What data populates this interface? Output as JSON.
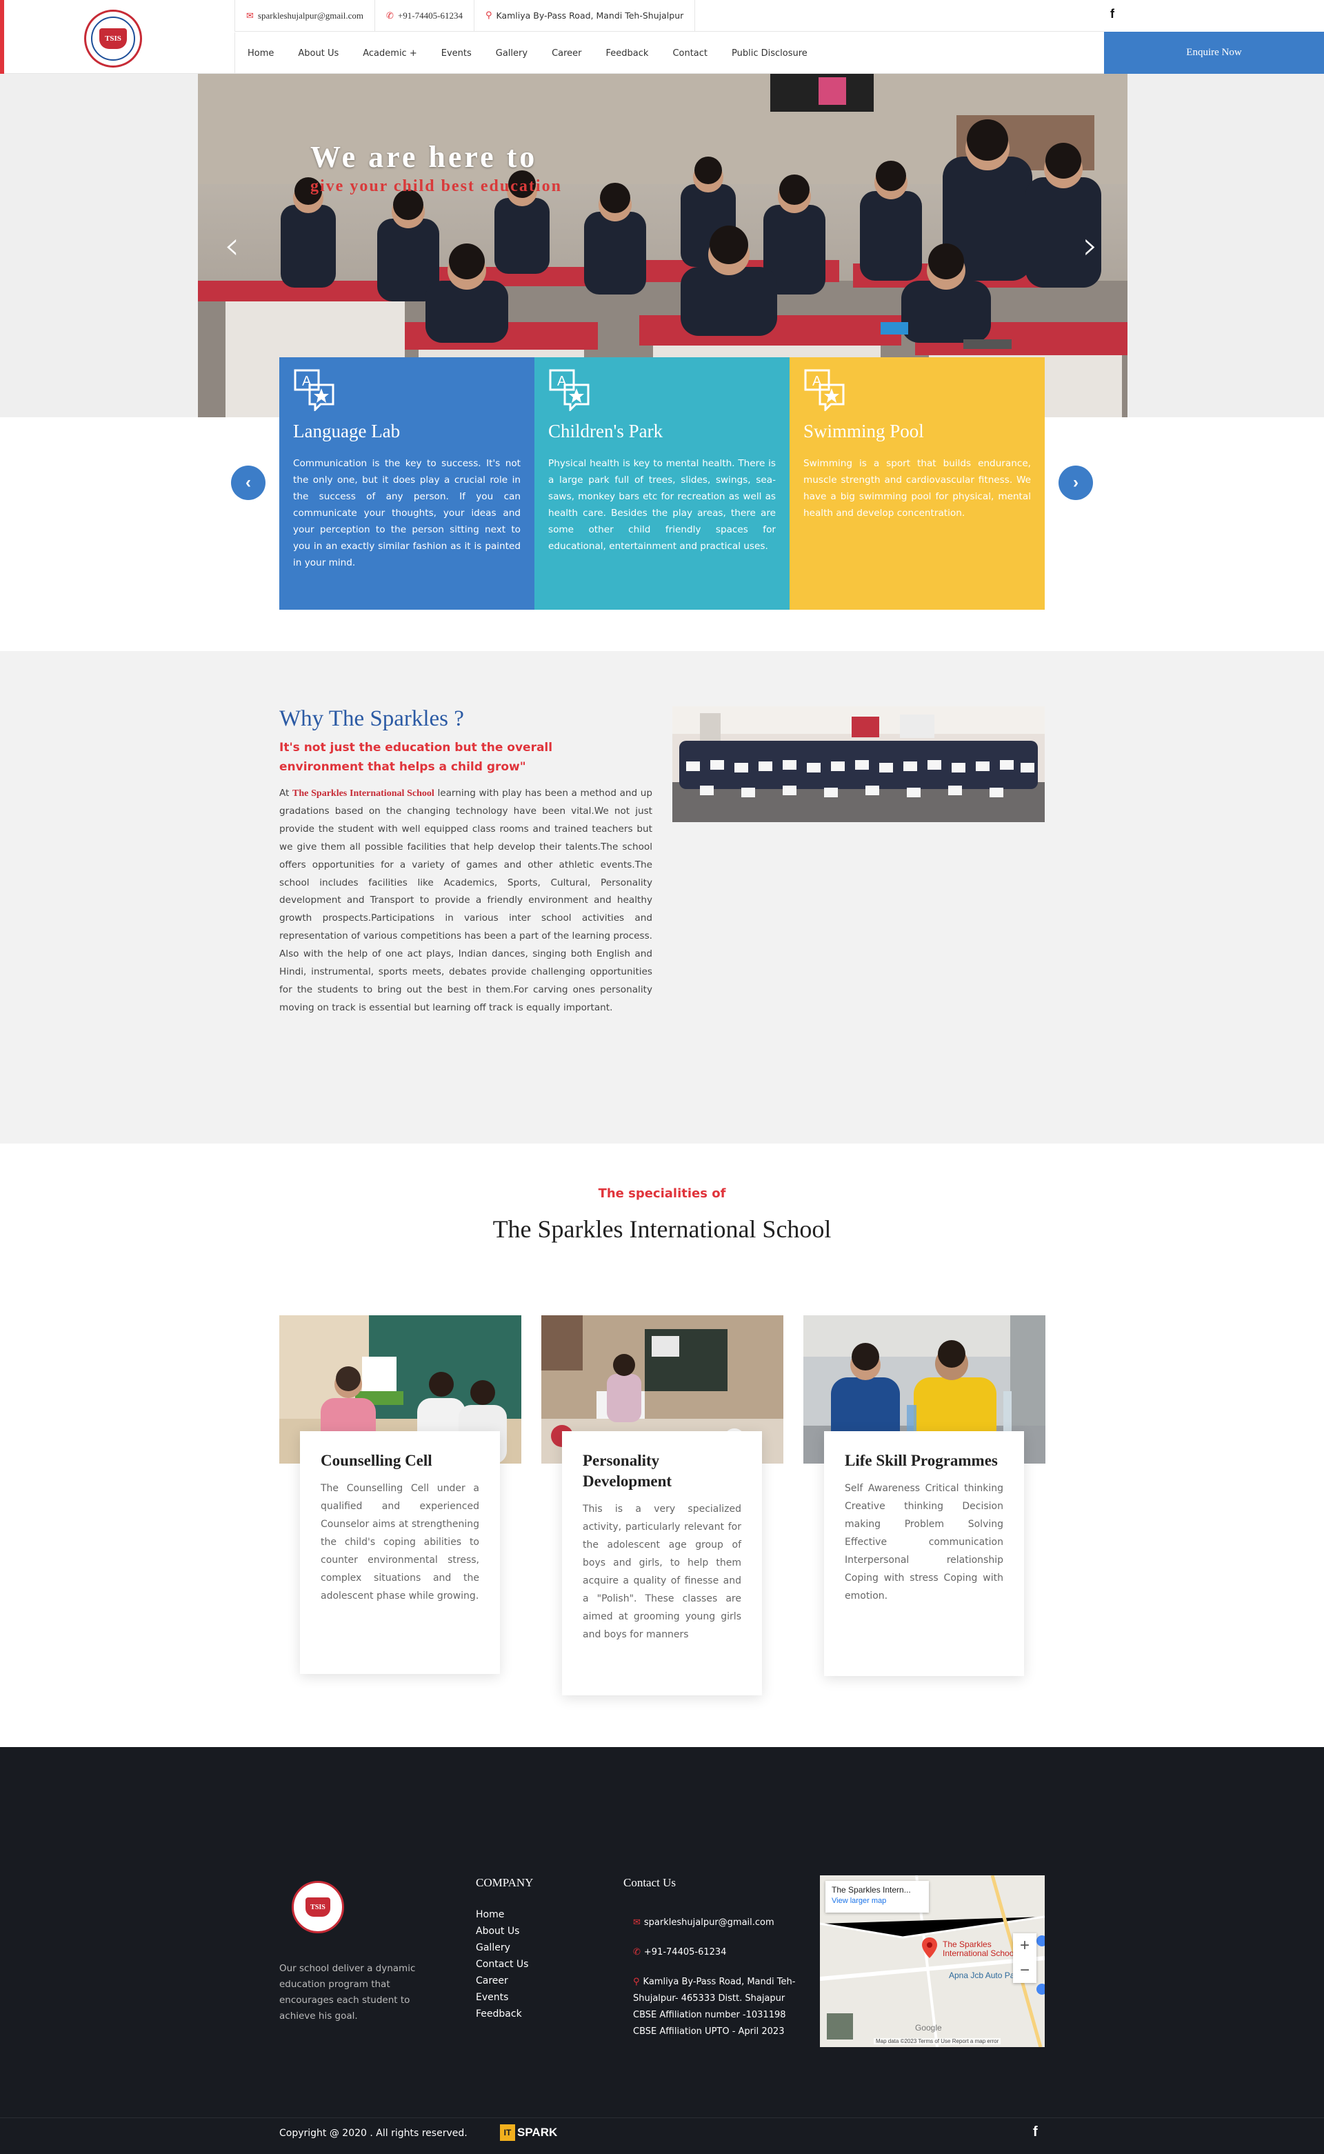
{
  "header": {
    "email": "sparkleshujalpur@gmail.com",
    "phone": "+91-74405-61234",
    "address": "Kamliya By-Pass Road, Mandi Teh-Shujalpur",
    "social_icon": "facebook-icon",
    "logo_text": "TSIS",
    "nav": [
      "Home",
      "About Us",
      "Academic +",
      "Events",
      "Gallery",
      "Career",
      "Feedback",
      "Contact",
      "Public Disclosure"
    ],
    "cta": "Enquire Now"
  },
  "hero": {
    "line1": "We are here to",
    "line2": "give your child best education",
    "prev_icon": "chevron-left-icon",
    "next_icon": "chevron-right-icon"
  },
  "features": [
    {
      "title": "Language Lab",
      "color": "#3c7dc8",
      "icon": "language-icon",
      "text": "Communication is the key to success. It's not the only one, but it does play a crucial role in the success of any person. If you can communicate your thoughts, your ideas and your perception to the person sitting next to you in an exactly similar fashion as it is painted in your mind."
    },
    {
      "title": "Children's Park",
      "color": "#3ab4c8",
      "icon": "language-icon",
      "text": "Physical health is key to mental health. There is a large park full of trees, slides, swings, sea- saws, monkey bars etc for recreation as well as health care. Besides the play areas, there are some other child friendly spaces for educational, entertainment and practical uses."
    },
    {
      "title": "Swimming Pool",
      "color": "#f8c53e",
      "icon": "language-icon",
      "text": "Swimming is a sport that builds endurance, muscle strength and cardiovascular fitness. We have a big swimming pool for physical, mental health and develop concentration."
    }
  ],
  "why": {
    "title": "Why The Sparkles ?",
    "subtitle": "It's not just the education but the overall environment that helps a child grow\"",
    "body_prefix": "At",
    "school_name": "The Sparkles International School",
    "body": "learning with play has been a method and up gradations based on the changing technology have been vital.We not just provide the student with well equipped class rooms and trained teachers but we give them all possible facilities that help develop their talents.The school offers opportunities for a variety of games and other athletic events.The school includes facilities like Academics, Sports, Cultural, Personality development and Transport to provide a friendly environment and healthy growth prospects.Participations in various inter school activities and representation of various competitions has been a part of the learning process. Also with the help of one act plays, Indian dances, singing both English and Hindi, instrumental, sports meets, debates provide challenging opportunities for the students to bring out the best in them.For carving ones personality moving on track is essential but learning off track is equally important."
  },
  "specialities": {
    "subtitle": "The specialities of",
    "title": "The Sparkles International School",
    "items": [
      {
        "title": "Counselling Cell",
        "text": "The Counselling Cell under a qualified and experienced Counselor aims at strengthening the child's coping abilities to counter environmental stress, complex situations and the adolescent phase while growing."
      },
      {
        "title": "Personality Development",
        "text": "This is a very specialized activity, particularly relevant for the adolescent age group of boys and girls, to help them acquire a quality of finesse and a \"Polish\". These classes are aimed at grooming young girls and boys for manners"
      },
      {
        "title": "Life Skill Programmes",
        "text": "Self Awareness Critical thinking Creative thinking Decision making Problem Solving Effective communication Interpersonal relationship Coping with stress Coping with emotion."
      }
    ]
  },
  "footer": {
    "about": "Our school deliver a dynamic education program that encourages each student to achieve his goal.",
    "company_heading": "COMPANY",
    "links": [
      "Home",
      "About Us",
      "Gallery",
      "Contact Us",
      "Career",
      "Events",
      "Feedback"
    ],
    "contact_heading": "Contact Us",
    "email": "sparkleshujalpur@gmail.com",
    "phone": "+91-74405-61234",
    "address": "Kamliya By-Pass Road, Mandi Teh-Shujalpur- 465333 Distt. Shajapur",
    "affiliation": "CBSE Affiliation number -1031198",
    "affiliation_upto": "CBSE Affiliation UPTO - April 2023",
    "map_title": "The Sparkles Intern...",
    "map_link": "View larger map",
    "map_pin": "The Sparkles International School",
    "map_road": "Apna Jcb Auto Parts",
    "map_google": "Google",
    "map_footer": "Map data ©2023   Terms of Use   Report a map error",
    "copyright": "Copyright @ 2020 . All rights reserved.",
    "brand": "SPARK",
    "brand_badge": "IT"
  }
}
